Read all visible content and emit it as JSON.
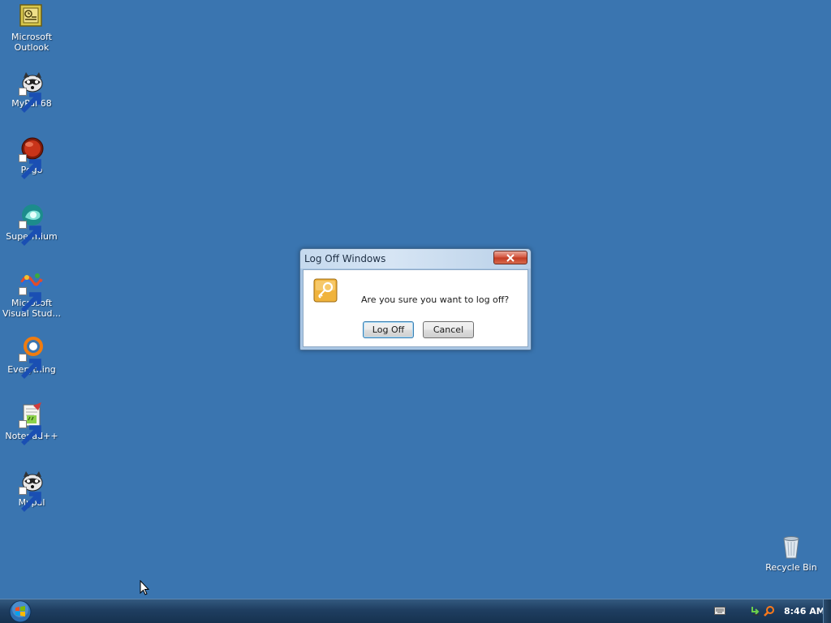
{
  "desktop": {
    "background_color": "#3a75b0",
    "icons": [
      {
        "label": "Microsoft Outlook",
        "icon": "outlook-icon",
        "shortcut": false
      },
      {
        "label": "MyPal 68",
        "icon": "raccoon-icon",
        "shortcut": true
      },
      {
        "label": "Pego",
        "icon": "pego-icon",
        "shortcut": true
      },
      {
        "label": "Supermium",
        "icon": "supermium-icon",
        "shortcut": true
      },
      {
        "label": "Microsoft Visual Stud...",
        "icon": "visual-studio-icon",
        "shortcut": true
      },
      {
        "label": "Everything",
        "icon": "everything-icon",
        "shortcut": true
      },
      {
        "label": "Notepad++",
        "icon": "notepad-plus-plus-icon",
        "shortcut": true
      },
      {
        "label": "Mypal",
        "icon": "raccoon-icon",
        "shortcut": true
      }
    ],
    "recycle_bin": {
      "label": "Recycle Bin",
      "icon": "recycle-bin-icon"
    }
  },
  "dialog": {
    "title": "Log Off Windows",
    "message": "Are you sure you want to log off?",
    "icon": "key-icon",
    "buttons": {
      "log_off": "Log Off",
      "cancel": "Cancel"
    }
  },
  "taskbar": {
    "clock": "8:46 AM",
    "tray_icons": [
      "keyboard-icon",
      "sync-icon",
      "search-icon"
    ],
    "start_icon": "windows-orb-icon"
  }
}
